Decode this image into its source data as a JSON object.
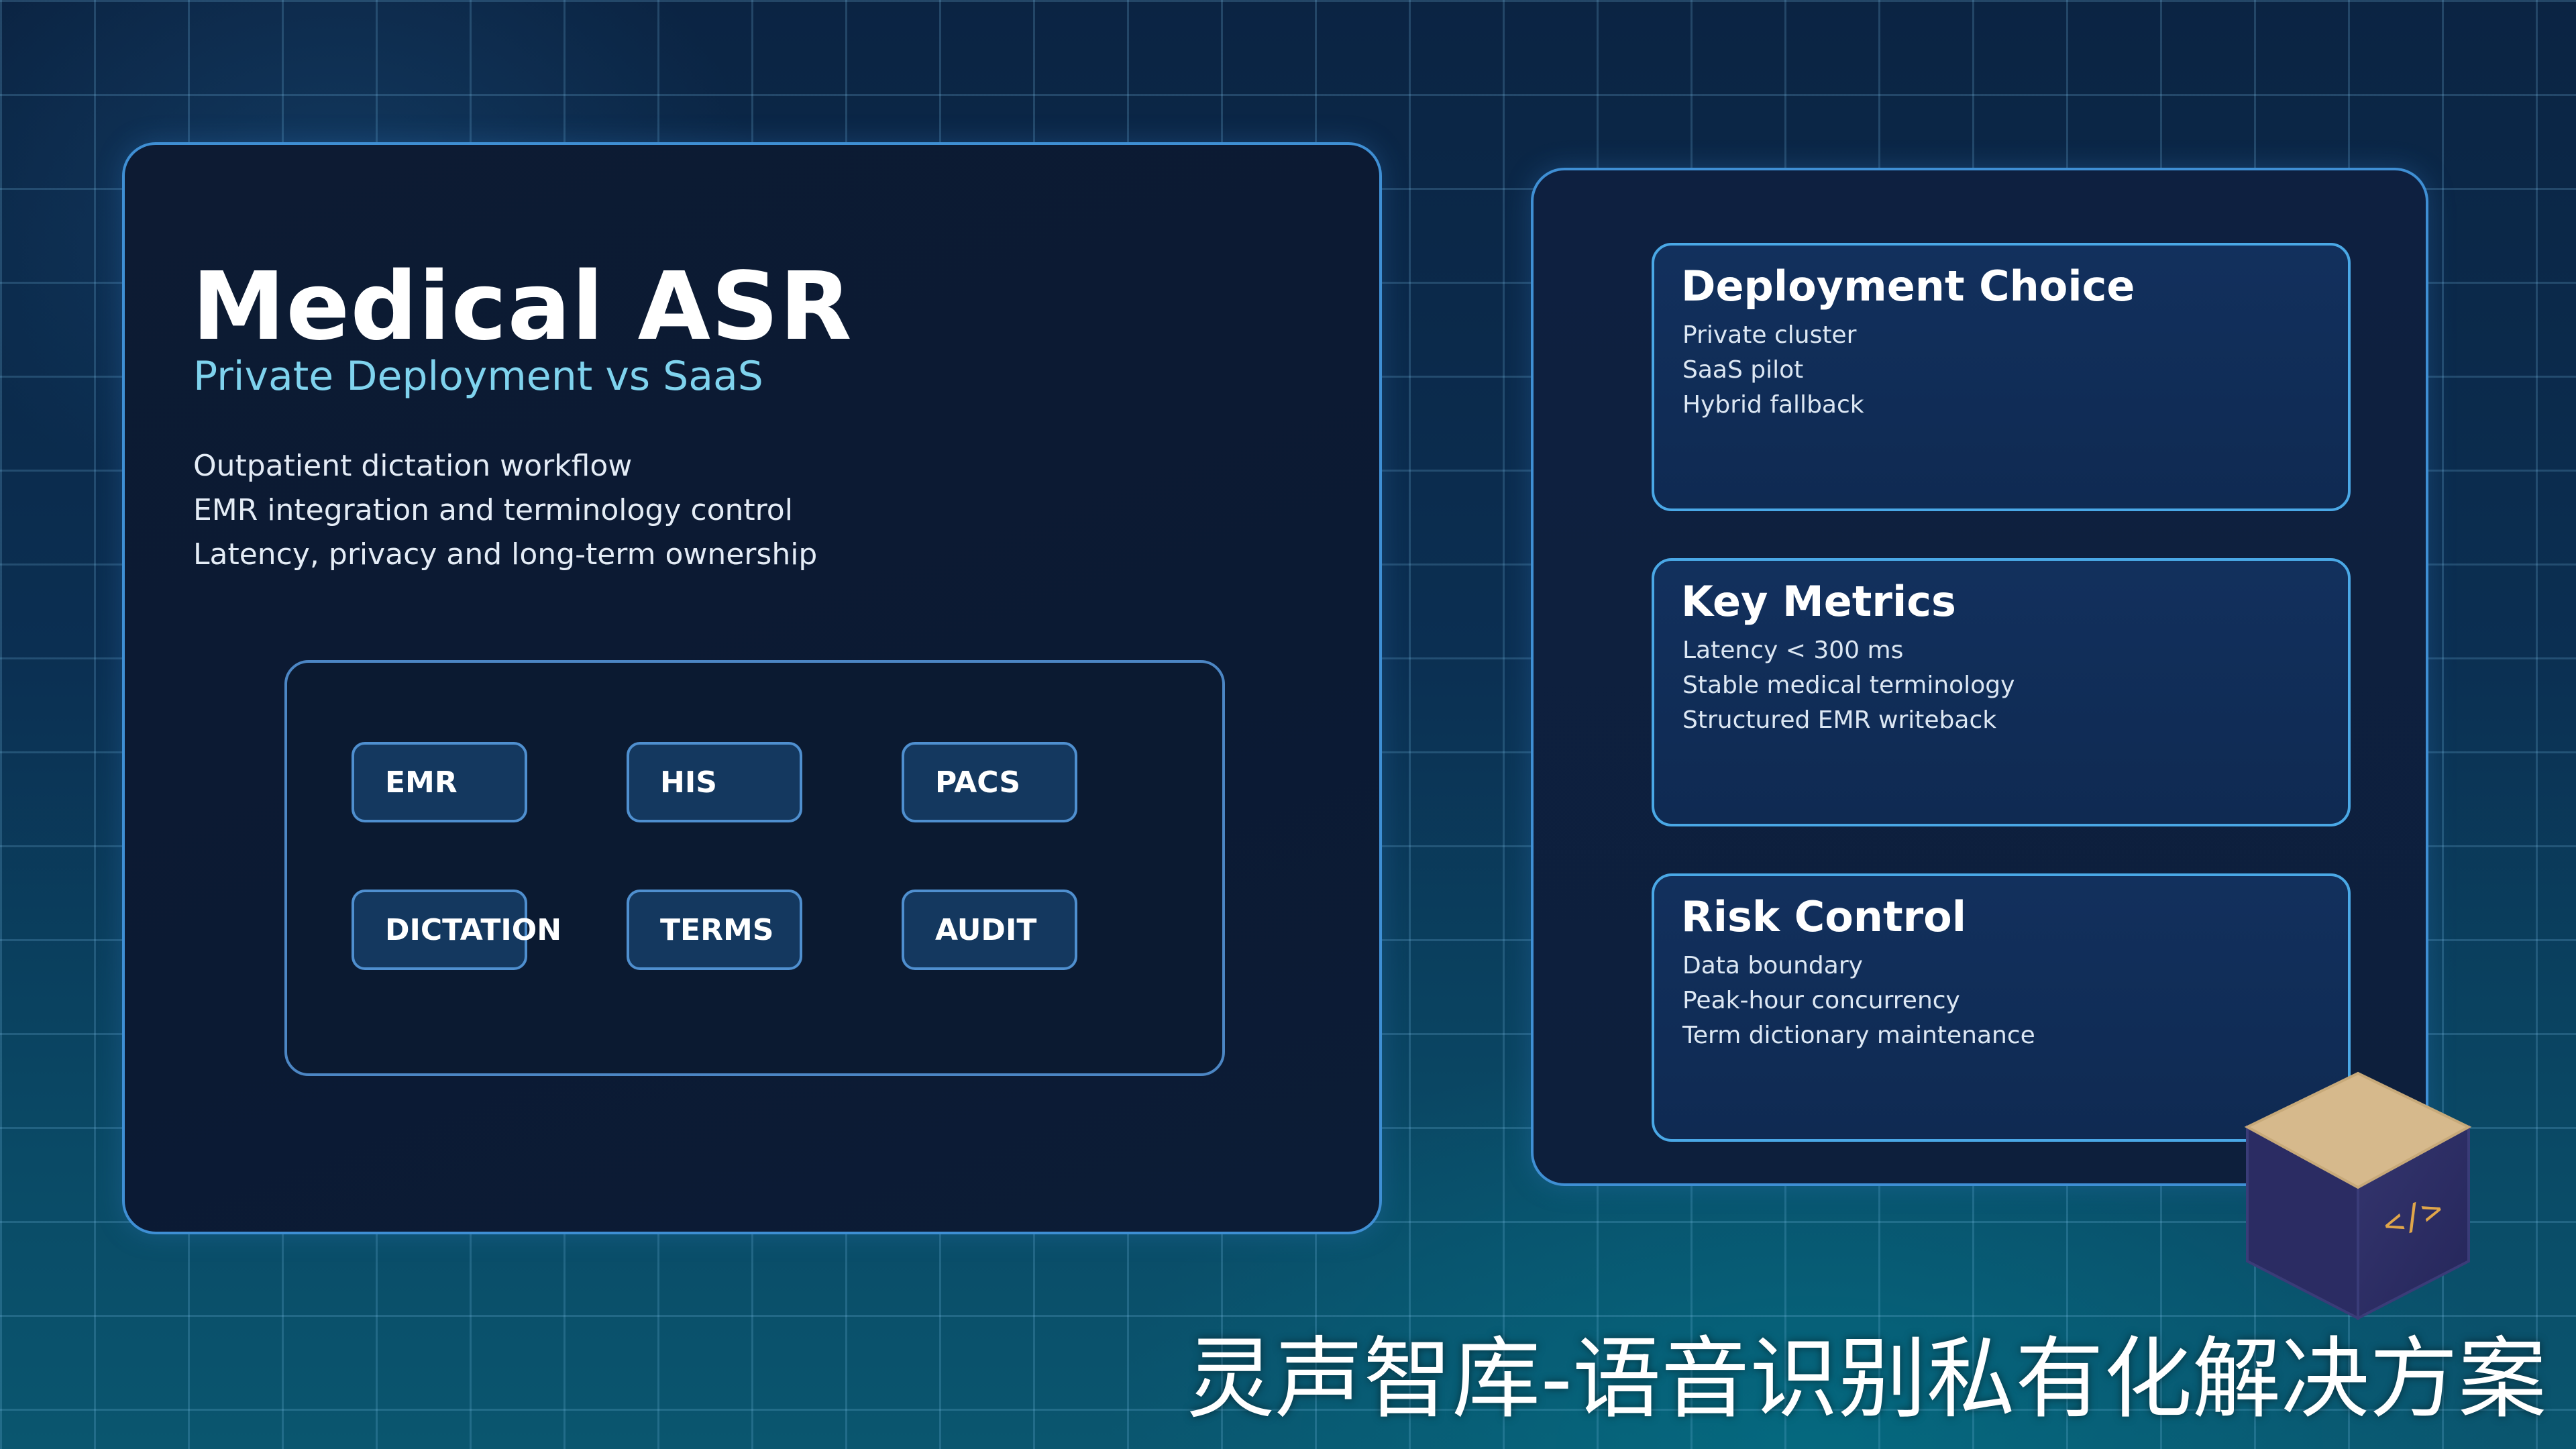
{
  "hero": {
    "title": "Medical ASR",
    "subtitle": "Private Deployment vs SaaS",
    "bullets": [
      "Outpatient dictation workflow",
      "EMR integration and terminology control",
      "Latency, privacy and long-term ownership"
    ]
  },
  "tags": [
    "EMR",
    "HIS",
    "PACS",
    "DICTATION",
    "TERMS",
    "AUDIT"
  ],
  "cards": [
    {
      "title": "Deployment Choice",
      "lines": [
        "Private cluster",
        "SaaS pilot",
        "Hybrid fallback"
      ]
    },
    {
      "title": "Key Metrics",
      "lines": [
        "Latency < 300 ms",
        "Stable medical terminology",
        "Structured EMR writeback"
      ]
    },
    {
      "title": "Risk Control",
      "lines": [
        "Data boundary",
        "Peak-hour concurrency",
        "Term dictionary maintenance"
      ]
    }
  ],
  "cube": {
    "icon": "code-icon",
    "icon_text": "</>",
    "top_color": "#d6b98c",
    "body_color": "#2e2f66"
  },
  "caption": "灵声智库-语音识别私有化解决方案",
  "colors": {
    "accent": "#7fd3ee",
    "panel_border": "#3f8fd4",
    "card_border": "#4aa8e6",
    "tag_fill": "#14385f"
  }
}
